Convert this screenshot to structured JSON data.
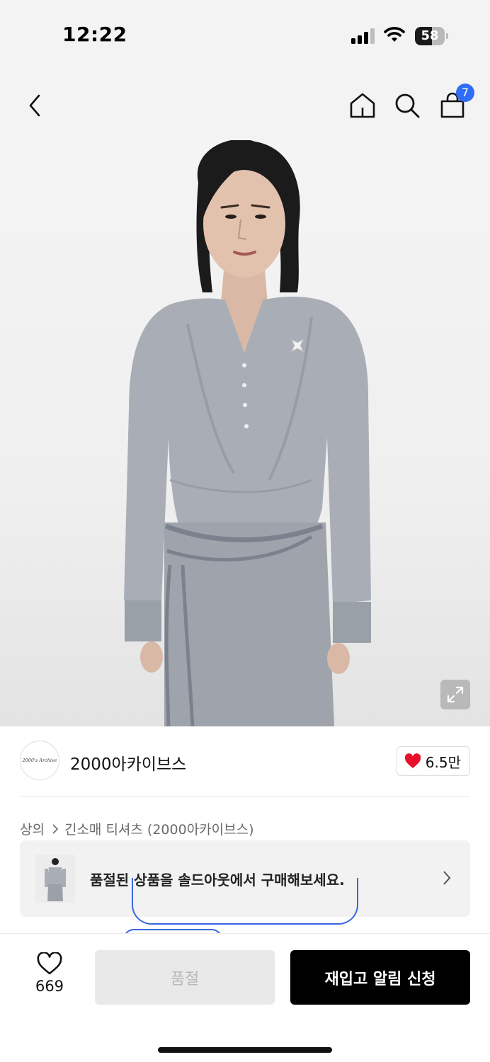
{
  "status_bar": {
    "time": "12:22",
    "battery_percent": "58",
    "battery_level": 0.58,
    "signal_bars": 3
  },
  "nav": {
    "back_icon": "chevron-left-icon",
    "home_icon": "home-icon",
    "search_icon": "search-icon",
    "cart_icon": "shopping-bag-icon",
    "cart_count": "7"
  },
  "product_image": {
    "zoom_icon": "expand-icon"
  },
  "brand": {
    "logo_text": "2000's Archive",
    "name": "2000아카이브스",
    "likes": "6.5만",
    "heart_color": "#e8102b"
  },
  "breadcrumb": {
    "category": "상의",
    "subcategory": "긴소매 티셔츠 (2000아카이브스)"
  },
  "soldout_banner": {
    "text": "품절된 상품을 솔드아웃에서 구매해보세요."
  },
  "bottom_bar": {
    "wish_count": "669",
    "soldout_label": "품절",
    "restock_label": "재입고 알림 신청"
  },
  "colors": {
    "accent_blue": "#2f6df6",
    "primary_button": "#000000",
    "disabled_button": "#e9e9e9"
  }
}
